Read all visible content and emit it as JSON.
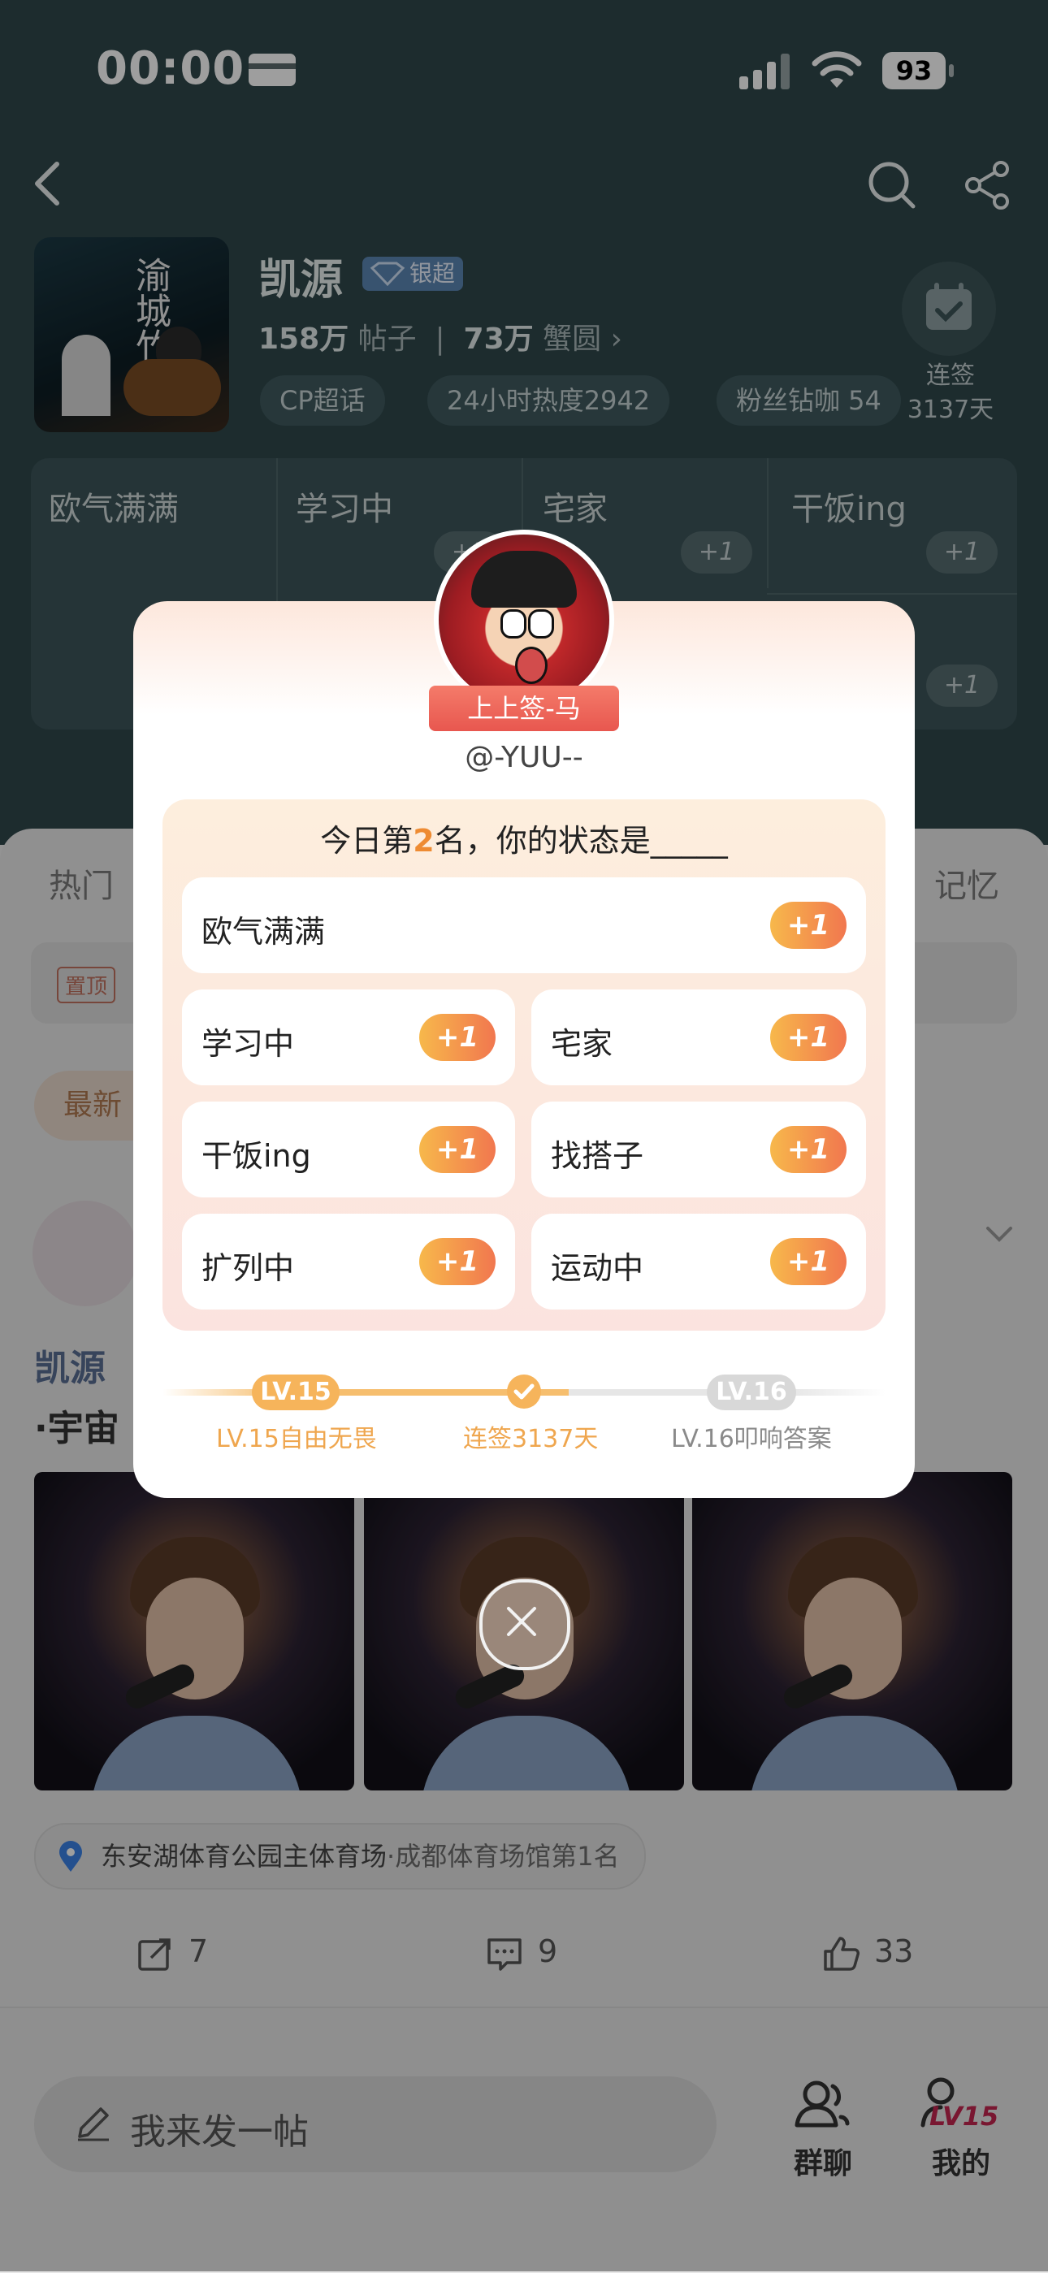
{
  "status_bar": {
    "time": "00:00",
    "battery": "93"
  },
  "topic": {
    "name": "凯源",
    "badge_label": "银超",
    "posts_count": "158万",
    "posts_label": "帖子",
    "members_count": "73万",
    "members_label": "蟹圆",
    "tags": [
      "CP超话",
      "24小时热度2942",
      "粉丝钻咖 54"
    ],
    "signin_label_1": "连签",
    "signin_label_2": "3137天",
    "cover_title": "渝城竹马"
  },
  "hot_grid": {
    "items": [
      "欧气满满",
      "学习中",
      "宅家",
      "干饭ing"
    ],
    "plus": "+1"
  },
  "page": {
    "tabs": [
      "热门",
      "记忆"
    ],
    "pinned_label": "置顶",
    "latest_label": "最新",
    "post_name": "凯源",
    "post_text": "·宇宙",
    "location": {
      "name": "东安湖体育公园主体育场",
      "rank": "·成都体育场馆第1名"
    },
    "actions": {
      "reposts": "7",
      "comments": "9",
      "likes": "33"
    },
    "compose_placeholder": "我来发一帖",
    "nav": {
      "group_chat": "群聊",
      "mine": "我的",
      "level_badge": "LV15"
    }
  },
  "modal": {
    "ribbon": "上上签-马",
    "username": "@-YUU--",
    "rank_prefix": "今日第",
    "rank": "2",
    "rank_suffix": "名，你的状态是_____",
    "options": [
      "欧气满满",
      "学习中",
      "宅家",
      "干饭ing",
      "找搭子",
      "扩列中",
      "运动中"
    ],
    "plus": "+1",
    "progress": {
      "current_level": "LV.15",
      "next_level": "LV.16",
      "current_title": "LV.15自由无畏",
      "streak": "连签3137天",
      "next_title": "LV.16叩响答案"
    }
  },
  "colors": {
    "accent_orange": "#f1774f",
    "accent_gold": "#f6b45b",
    "header_bg": "#2f474b"
  }
}
